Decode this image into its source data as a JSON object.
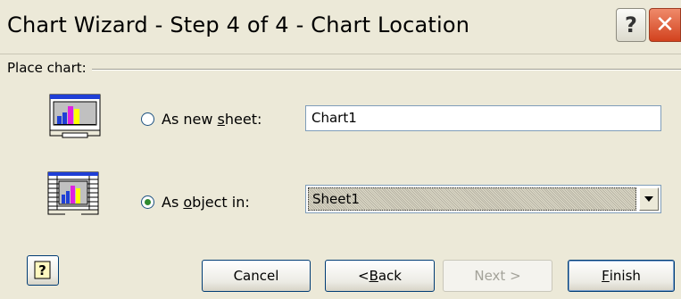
{
  "window": {
    "title": "Chart Wizard - Step 4 of 4 - Chart Location",
    "help_glyph": "?",
    "close_glyph": "✕"
  },
  "group": {
    "label": "Place chart:"
  },
  "options": {
    "new_sheet": {
      "label_pre": "As new ",
      "label_accel": "s",
      "label_post": "heet:",
      "selected": false,
      "value": "Chart1"
    },
    "object_in": {
      "label_pre": "As ",
      "label_accel": "o",
      "label_post": "bject in:",
      "selected": true,
      "value": "Sheet1"
    }
  },
  "buttons": {
    "help_glyph": "?",
    "cancel": "Cancel",
    "back_pre": "< ",
    "back_accel": "B",
    "back_post": "ack",
    "next": "Next >",
    "finish_accel": "F",
    "finish_post": "inish"
  },
  "icons": {
    "new_sheet": "chart-sheet-icon",
    "object_in": "embedded-chart-icon",
    "dropdown": "chevron-down-icon",
    "help": "office-assistant-help-icon"
  }
}
